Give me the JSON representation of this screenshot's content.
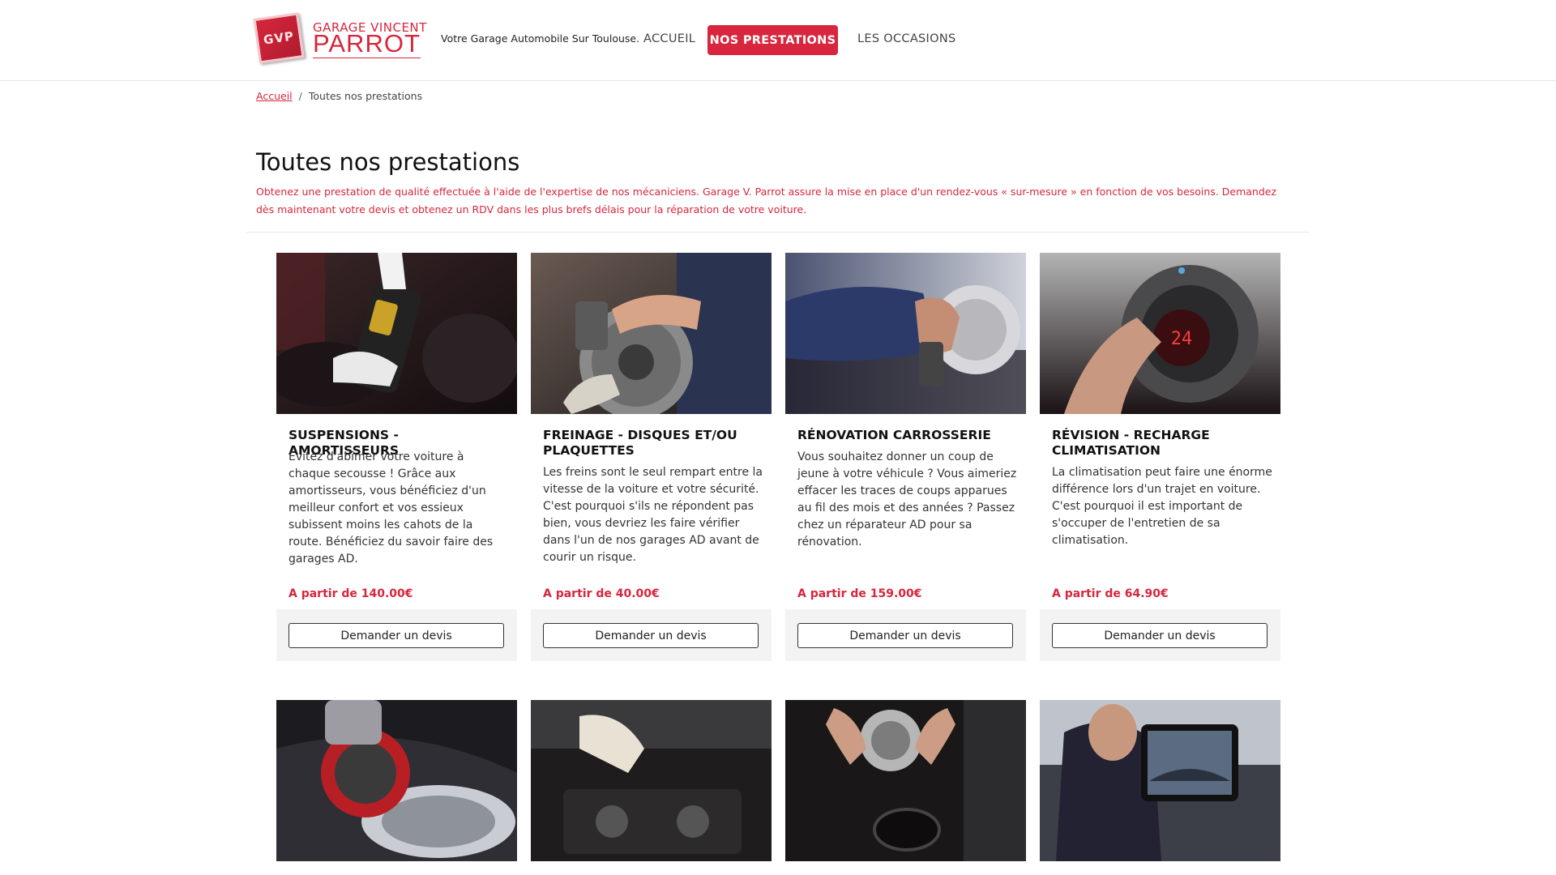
{
  "header": {
    "logo_small": "GARAGE VINCENT",
    "logo_big": "PARROT",
    "logo_mark": "GVP",
    "tagline": "Votre Garage Automobile Sur Toulouse.",
    "nav": [
      {
        "label": "ACCUEIL"
      },
      {
        "label": "NOS PRESTATIONS"
      },
      {
        "label": "LES OCCASIONS"
      }
    ]
  },
  "breadcrumb": {
    "home": "Accueil",
    "current": "Toutes nos prestations"
  },
  "page": {
    "title": "Toutes nos prestations",
    "intro": "Obtenez une prestation de qualité effectuée à l'aide de l'expertise de nos mécaniciens. Garage V. Parrot assure la mise en place d'un rendez-vous « sur-mesure » en fonction de vos besoins. Demandez dès maintenant votre devis et obtenez un RDV dans les plus brefs délais pour la réparation de votre voiture."
  },
  "services": [
    {
      "title": "SUSPENSIONS - AMORTISSEURS",
      "description": "Évitez d'abîmer votre voiture à chaque secousse ! Grâce aux amortisseurs, vous bénéficiez d'un meilleur confort et vos essieux subissent moins les cahots de la route. Bénéficiez du savoir faire des garages AD.",
      "price": "A partir de 140.00€",
      "button": "Demander un devis",
      "image_icon": "suspension-image"
    },
    {
      "title": "FREINAGE - DISQUES ET/OU PLAQUETTES",
      "description": "Les freins sont le seul rempart entre la vitesse de la voiture et votre sécurité. C'est pourquoi s'ils ne répondent pas bien, vous devriez les faire vérifier dans l'un de nos garages AD avant de courir un risque.",
      "price": "A partir de 40.00€",
      "button": "Demander un devis",
      "image_icon": "brake-disc-image"
    },
    {
      "title": "RÉNOVATION CARROSSERIE",
      "description": "Vous souhaitez donner un coup de jeune à votre véhicule ? Vous aimeriez effacer les traces de coups apparues au fil des mois et des années ? Passez chez un réparateur AD pour sa rénovation.",
      "price": "A partir de 159.00€",
      "button": "Demander un devis",
      "image_icon": "bodywork-polish-image"
    },
    {
      "title": "RÉVISION - RECHARGE CLIMATISATION",
      "description": "La climatisation peut faire une énorme différence lors d'un trajet en voiture. C'est pourquoi il est important de s'occuper de l'entretien de sa climatisation.",
      "price": "A partir de 64.90€",
      "button": "Demander un devis",
      "image_icon": "climate-control-image"
    }
  ],
  "second_row_images": [
    "headlight-polish-image",
    "engine-repair-image",
    "radiator-cap-image",
    "diagnostic-tablet-image"
  ],
  "colors": {
    "accent": "#d7263d",
    "footer_bg": "#f3f3f3"
  }
}
